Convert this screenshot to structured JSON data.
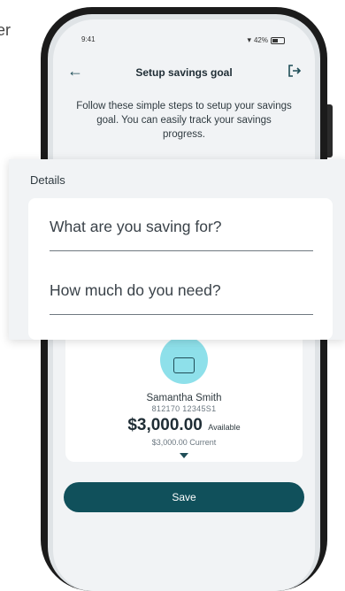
{
  "corner_text": "er",
  "status_bar": {
    "time": "9:41",
    "battery": "42%"
  },
  "header": {
    "title": "Setup savings goal",
    "back_icon": "arrow-left-icon",
    "logout_icon": "logout-icon"
  },
  "intro": "Follow these simple steps to setup your savings goal. You can easily track your savings progress.",
  "details": {
    "title": "Details",
    "field_purpose_label": "What are you saving for?",
    "field_amount_label": "How much do you need?"
  },
  "account": {
    "name": "Samantha Smith",
    "number": "812170  12345S1",
    "amount": "$3,000.00",
    "available_label": "Available",
    "current": "$3,000.00 Current"
  },
  "save_label": "Save",
  "colors": {
    "primary": "#10505b",
    "accent": "#8ee0ea",
    "background": "#f1f3f5"
  }
}
